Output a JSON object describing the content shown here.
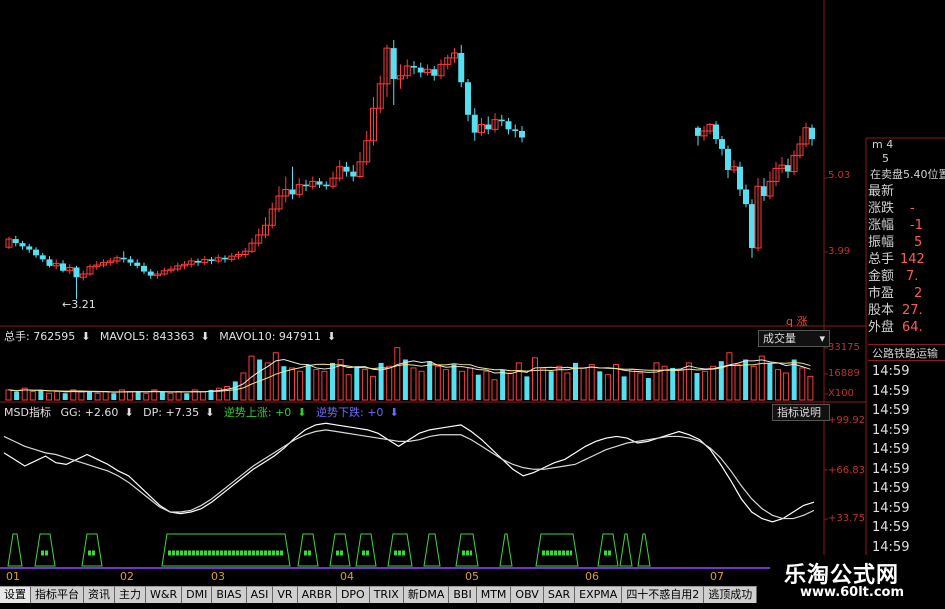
{
  "price_panel": {
    "low_label": "3.21",
    "high_ticks": [
      "5.03",
      "3.99"
    ],
    "q_label": "q 涨"
  },
  "volume_panel": {
    "total_hands": "总手: 762595",
    "mavol5": "MAVOL5: 843363",
    "mavol10": "MAVOL10: 947911",
    "button": "成交量",
    "ticks": [
      "33175",
      "16889",
      "X100"
    ]
  },
  "msd_panel": {
    "title": "MSD指标",
    "gg": "GG: +2.60",
    "dp": "DP: +7.35",
    "up_label": "逆势上涨: +0",
    "down_label": "逆势下跌: +0",
    "button": "指标说明",
    "ticks": [
      "+99.92",
      "+66.83",
      "+33.75"
    ]
  },
  "months": [
    "01",
    "02",
    "03",
    "04",
    "05",
    "06",
    "07"
  ],
  "side_panel": {
    "top": [
      "m 4",
      "5"
    ],
    "sell_label": "在卖盘5.40位置",
    "rows": [
      {
        "label": "最新",
        "value": ""
      },
      {
        "label": "涨跌",
        "value": "-"
      },
      {
        "label": "涨幅",
        "value": "-1"
      },
      {
        "label": "振幅",
        "value": "5"
      },
      {
        "label": "总手",
        "value": "142"
      },
      {
        "label": "金额",
        "value": "7."
      },
      {
        "label": "市盈",
        "value": "2"
      },
      {
        "label": "股本",
        "value": "27."
      },
      {
        "label": "外盘",
        "value": "64."
      }
    ],
    "highway_label": "公路铁路运输",
    "times": [
      "14:59",
      "14:59",
      "14:59",
      "14:59",
      "14:59",
      "14:59",
      "14:59",
      "14:59",
      "14:59",
      "14:59",
      "14:59"
    ]
  },
  "tabs": [
    "设置",
    "指标平台",
    "资讯",
    "主力",
    "W&R",
    "DMI",
    "BIAS",
    "ASI",
    "VR",
    "ARBR",
    "DPO",
    "TRIX",
    "新DMA",
    "BBI",
    "MTM",
    "OBV",
    "SAR",
    "EXPMA",
    "四十不惑自用2",
    "逃顶成功"
  ],
  "watermark": {
    "title": "乐淘公式网",
    "url": "www.60lt.com"
  },
  "colors": {
    "up": "#ff3b3b",
    "down": "#54e0f0",
    "axis": "#8b1a1a",
    "signal": "#3ad93a",
    "bottom_line": "#7a2fd0"
  },
  "chart_data": {
    "type": "candlestick",
    "price_candles": [
      [
        3.85,
        3.95,
        3.83,
        3.98
      ],
      [
        3.95,
        3.9,
        3.86,
        3.99
      ],
      [
        3.9,
        3.86,
        3.82,
        3.93
      ],
      [
        3.86,
        3.82,
        3.78,
        3.89
      ],
      [
        3.82,
        3.75,
        3.72,
        3.85
      ],
      [
        3.75,
        3.7,
        3.67,
        3.78
      ],
      [
        3.7,
        3.62,
        3.6,
        3.74
      ],
      [
        3.62,
        3.65,
        3.58,
        3.7
      ],
      [
        3.65,
        3.56,
        3.54,
        3.69
      ],
      [
        3.56,
        3.6,
        3.52,
        3.64
      ],
      [
        3.6,
        3.48,
        3.21,
        3.62
      ],
      [
        3.48,
        3.52,
        3.44,
        3.56
      ],
      [
        3.52,
        3.61,
        3.5,
        3.64
      ],
      [
        3.61,
        3.63,
        3.57,
        3.68
      ],
      [
        3.63,
        3.66,
        3.6,
        3.7
      ],
      [
        3.66,
        3.68,
        3.62,
        3.72
      ],
      [
        3.68,
        3.72,
        3.64,
        3.75
      ],
      [
        3.72,
        3.7,
        3.66,
        3.8
      ],
      [
        3.7,
        3.66,
        3.62,
        3.74
      ],
      [
        3.66,
        3.62,
        3.59,
        3.7
      ],
      [
        3.62,
        3.55,
        3.52,
        3.66
      ],
      [
        3.55,
        3.5,
        3.46,
        3.58
      ],
      [
        3.5,
        3.52,
        3.46,
        3.56
      ],
      [
        3.52,
        3.56,
        3.5,
        3.6
      ],
      [
        3.56,
        3.58,
        3.53,
        3.62
      ],
      [
        3.58,
        3.62,
        3.55,
        3.66
      ],
      [
        3.62,
        3.64,
        3.58,
        3.68
      ],
      [
        3.64,
        3.68,
        3.6,
        3.72
      ],
      [
        3.68,
        3.66,
        3.62,
        3.71
      ],
      [
        3.66,
        3.7,
        3.63,
        3.74
      ],
      [
        3.7,
        3.68,
        3.64,
        3.73
      ],
      [
        3.68,
        3.72,
        3.65,
        3.76
      ],
      [
        3.72,
        3.7,
        3.66,
        3.75
      ],
      [
        3.7,
        3.74,
        3.67,
        3.78
      ],
      [
        3.74,
        3.76,
        3.7,
        3.8
      ],
      [
        3.76,
        3.8,
        3.72,
        3.84
      ],
      [
        3.8,
        3.9,
        3.78,
        3.96
      ],
      [
        3.9,
        4.0,
        3.86,
        4.08
      ],
      [
        4.0,
        4.12,
        3.96,
        4.22
      ],
      [
        4.12,
        4.32,
        4.08,
        4.4
      ],
      [
        4.32,
        4.48,
        4.28,
        4.6
      ],
      [
        4.48,
        4.56,
        4.4,
        4.72
      ],
      [
        4.56,
        4.5,
        4.44,
        4.84
      ],
      [
        4.5,
        4.62,
        4.46,
        4.7
      ],
      [
        4.62,
        4.6,
        4.54,
        4.68
      ],
      [
        4.6,
        4.66,
        4.56,
        4.72
      ],
      [
        4.66,
        4.62,
        4.58,
        4.7
      ],
      [
        4.62,
        4.6,
        4.56,
        4.66
      ],
      [
        4.6,
        4.7,
        4.57,
        4.78
      ],
      [
        4.7,
        4.84,
        4.66,
        4.92
      ],
      [
        4.84,
        4.78,
        4.72,
        4.9
      ],
      [
        4.78,
        4.72,
        4.66,
        4.86
      ],
      [
        4.72,
        4.9,
        4.7,
        5.02
      ],
      [
        4.9,
        5.16,
        4.86,
        5.28
      ],
      [
        5.16,
        5.56,
        5.1,
        5.7
      ],
      [
        5.56,
        5.86,
        5.5,
        5.96
      ],
      [
        5.86,
        6.3,
        5.7,
        6.34
      ],
      [
        6.3,
        5.92,
        5.6,
        6.4
      ],
      [
        5.92,
        5.96,
        5.8,
        6.1
      ],
      [
        5.96,
        6.08,
        5.92,
        6.16
      ],
      [
        6.08,
        6.06,
        5.98,
        6.14
      ],
      [
        6.06,
        6.0,
        5.94,
        6.12
      ],
      [
        6.0,
        6.04,
        5.96,
        6.1
      ],
      [
        6.04,
        5.96,
        5.9,
        6.08
      ],
      [
        5.96,
        6.1,
        5.92,
        6.16
      ],
      [
        6.1,
        6.18,
        6.04,
        6.22
      ],
      [
        6.18,
        6.24,
        6.12,
        6.3
      ],
      [
        6.24,
        5.88,
        5.82,
        6.34
      ],
      [
        5.88,
        5.48,
        5.4,
        5.92
      ],
      [
        5.48,
        5.26,
        5.16,
        5.56
      ],
      [
        5.26,
        5.36,
        5.22,
        5.44
      ],
      [
        5.36,
        5.3,
        5.24,
        5.46
      ],
      [
        5.3,
        5.42,
        5.26,
        5.5
      ],
      [
        5.42,
        5.4,
        5.34,
        5.48
      ],
      [
        5.4,
        5.3,
        5.24,
        5.44
      ],
      [
        5.3,
        5.28,
        5.2,
        5.36
      ],
      [
        5.28,
        5.2,
        5.14,
        5.34
      ]
    ],
    "price_candles_right": [
      [
        5.32,
        5.22,
        5.1,
        5.34
      ],
      [
        5.22,
        5.28,
        5.16,
        5.34
      ],
      [
        5.28,
        5.36,
        5.24,
        5.38
      ],
      [
        5.36,
        5.18,
        5.12,
        5.4
      ],
      [
        5.18,
        5.06,
        4.98,
        5.22
      ],
      [
        5.06,
        4.8,
        4.7,
        5.1
      ],
      [
        4.8,
        4.84,
        4.76,
        4.92
      ],
      [
        4.84,
        4.56,
        4.48,
        4.9
      ],
      [
        4.56,
        4.38,
        4.34,
        4.62
      ],
      [
        4.38,
        3.84,
        3.72,
        4.44
      ],
      [
        3.84,
        4.6,
        3.8,
        4.7
      ],
      [
        4.6,
        4.48,
        4.42,
        4.7
      ],
      [
        4.48,
        4.66,
        4.44,
        4.78
      ],
      [
        4.66,
        4.82,
        4.6,
        4.9
      ],
      [
        4.82,
        4.86,
        4.76,
        4.96
      ],
      [
        4.86,
        4.78,
        4.7,
        4.94
      ],
      [
        4.78,
        4.98,
        4.74,
        5.04
      ],
      [
        4.98,
        5.12,
        4.94,
        5.22
      ],
      [
        5.12,
        5.32,
        5.08,
        5.38
      ],
      [
        5.32,
        5.18,
        5.1,
        5.36
      ]
    ],
    "volume": [
      6,
      5,
      7,
      5,
      6,
      4,
      5,
      4,
      6,
      5,
      5,
      4,
      5,
      4,
      6,
      5,
      5,
      4,
      6,
      5,
      4,
      5,
      4,
      6,
      5,
      6,
      7,
      8,
      11,
      16,
      26,
      24,
      22,
      28,
      20,
      19,
      17,
      21,
      18,
      17,
      22,
      24,
      15,
      20,
      18,
      14,
      22,
      20,
      31,
      24,
      19,
      17,
      23,
      20,
      18,
      21,
      17,
      19,
      15,
      17,
      12,
      18,
      16,
      22,
      14,
      25,
      19,
      17,
      20,
      16,
      22,
      19,
      21,
      17,
      15,
      21,
      14,
      18,
      16,
      13,
      22,
      20,
      19,
      18,
      22,
      16,
      17,
      20,
      23,
      28,
      21,
      24,
      20,
      26,
      22,
      18,
      16,
      24,
      19,
      14
    ],
    "msd_ticks": [
      99.92,
      66.83,
      33.75
    ],
    "msd_gg": [
      80,
      76,
      72,
      75,
      78,
      74,
      73,
      76,
      79,
      76,
      73,
      69,
      66,
      60,
      54,
      48,
      44,
      43,
      44,
      46,
      50,
      55,
      60,
      65,
      70,
      74,
      78,
      83,
      89,
      94,
      97,
      98,
      97,
      96,
      95,
      94,
      92,
      88,
      84,
      88,
      92,
      94,
      95,
      96,
      97,
      93,
      88,
      82,
      76,
      70,
      66,
      68,
      71,
      74,
      76,
      80,
      84,
      87,
      89,
      90,
      89,
      86,
      87,
      89,
      91,
      93,
      91,
      88,
      82,
      73,
      63,
      52,
      44,
      40,
      38,
      40,
      44,
      48,
      50
    ],
    "msd_dp": [
      90,
      87,
      84,
      82,
      80,
      79,
      77,
      75,
      73,
      71,
      69,
      66,
      62,
      57,
      52,
      47,
      44,
      44,
      45,
      48,
      52,
      57,
      62,
      67,
      72,
      76,
      80,
      84,
      88,
      91,
      93,
      94,
      93,
      92,
      91,
      90,
      89,
      88,
      87,
      87,
      88,
      90,
      91,
      91,
      91,
      88,
      84,
      80,
      76,
      73,
      71,
      70,
      70,
      71,
      72,
      73,
      76,
      79,
      82,
      84,
      86,
      87,
      88,
      89,
      90,
      90,
      89,
      87,
      83,
      77,
      69,
      60,
      52,
      46,
      42,
      40,
      40,
      42,
      45
    ]
  }
}
